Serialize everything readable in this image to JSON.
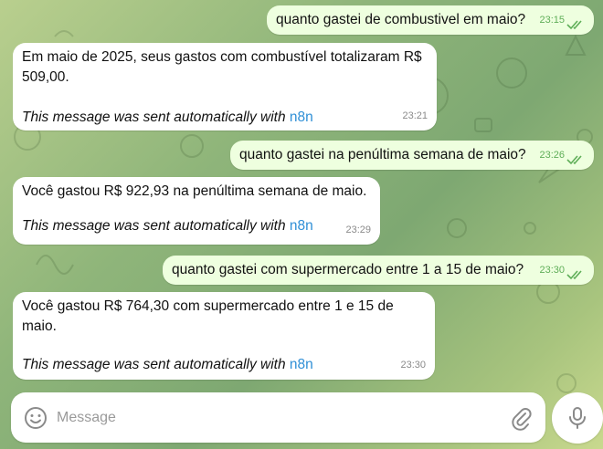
{
  "messages": [
    {
      "dir": "out",
      "text": "quanto gastei de combustivel em maio?",
      "time": "23:15"
    },
    {
      "dir": "in",
      "text": "Em maio de 2025, seus gastos com combustível totalizaram R$ 509,00.",
      "auto_prefix": "This message was sent automatically with",
      "auto_link": "n8n",
      "time": "23:21"
    },
    {
      "dir": "out",
      "text": "quanto gastei na penúltima semana de maio?",
      "time": "23:26"
    },
    {
      "dir": "in",
      "text": "Você gastou R$ 922,93 na penúltima semana de maio.",
      "auto_prefix": "This message was sent automatically with",
      "auto_link": "n8n",
      "time": "23:29"
    },
    {
      "dir": "out",
      "text": "quanto gastei com supermercado entre 1 a 15 de maio?",
      "time": "23:30"
    },
    {
      "dir": "in",
      "text": "Você gastou R$ 764,30 com supermercado entre 1 e 15 de maio.",
      "auto_prefix": "This message was sent automatically with",
      "auto_link": "n8n",
      "time": "23:30"
    }
  ],
  "composer": {
    "placeholder": "Message",
    "emoji_icon": "smile-icon",
    "attach_icon": "paperclip-icon",
    "mic_icon": "microphone-icon"
  },
  "colors": {
    "outgoing_bubble": "#eeffdf",
    "incoming_bubble": "#ffffff",
    "link": "#2f8fd6",
    "read_check": "#5fae58"
  }
}
